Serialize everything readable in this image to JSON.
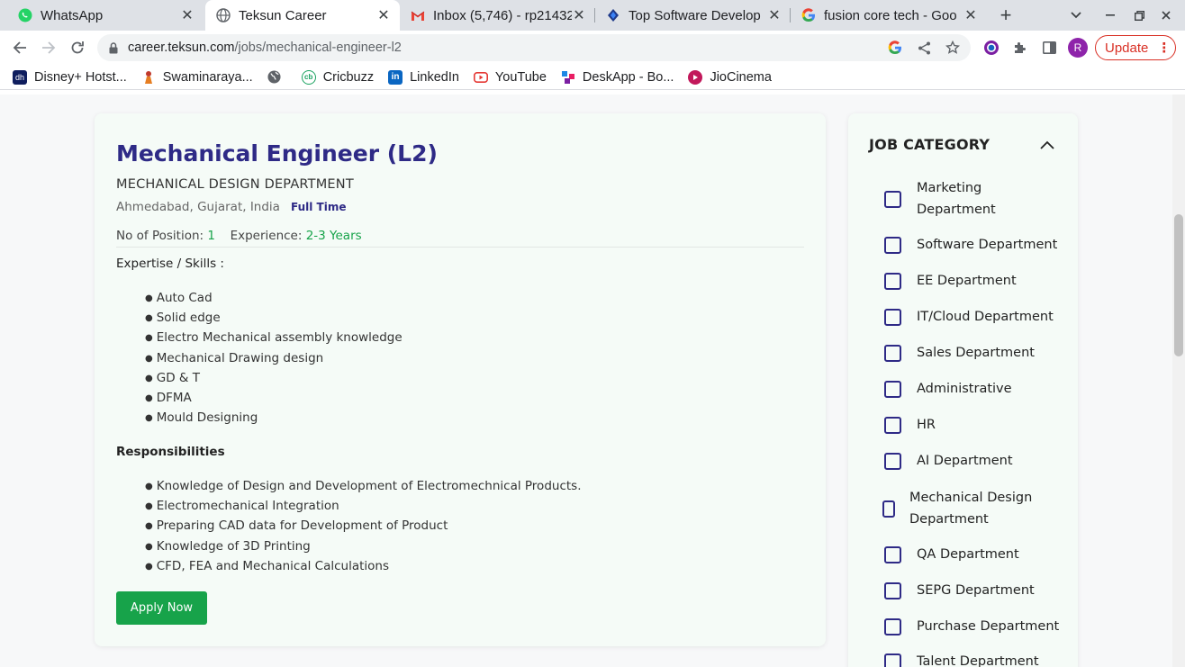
{
  "browser": {
    "tabs": [
      {
        "title": "WhatsApp",
        "icon": "whatsapp-icon"
      },
      {
        "title": "Teksun Career",
        "icon": "globe-icon"
      },
      {
        "title": "Inbox (5,746) - rp21432",
        "icon": "gmail-icon"
      },
      {
        "title": "Top Software Develop",
        "icon": "teksun-icon"
      },
      {
        "title": "fusion core tech - Goo",
        "icon": "google-icon"
      }
    ],
    "url_host": "career.teksun.com",
    "url_path": "/jobs/mechanical-engineer-l2",
    "avatar_letter": "R",
    "update_label": "Update",
    "bookmarks": [
      {
        "label": "Disney+ Hotst...",
        "icon": "hotstar-icon",
        "color": "#0f1e5e"
      },
      {
        "label": "Swaminaraya...",
        "icon": "swaminarayan-icon",
        "color": "#c0392b"
      },
      {
        "label": "",
        "icon": "globe-icon",
        "color": "#5f6368"
      },
      {
        "label": "Cricbuzz",
        "icon": "cricbuzz-icon",
        "color": "#1aa260"
      },
      {
        "label": "LinkedIn",
        "icon": "linkedin-icon",
        "color": "#0a66c2"
      },
      {
        "label": "YouTube",
        "icon": "youtube-icon",
        "color": "#e53935"
      },
      {
        "label": "DeskApp - Bo...",
        "icon": "deskapp-icon",
        "color": "#6a1b9a"
      },
      {
        "label": "JioCinema",
        "icon": "jiocinema-icon",
        "color": "#c2185b"
      }
    ]
  },
  "job": {
    "title": "Mechanical Engineer (L2)",
    "department": "MECHANICAL DESIGN DEPARTMENT",
    "location": "Ahmedabad, Gujarat, India",
    "type": "Full Time",
    "positions_label": "No of Position:",
    "positions_value": "1",
    "experience_label": "Experience:",
    "experience_value": "2-3 Years",
    "skills_heading": "Expertise / Skills :",
    "skills": [
      "Auto Cad",
      "Solid edge",
      "Electro Mechanical assembly knowledge",
      "Mechanical Drawing design",
      "GD & T",
      "DFMA",
      "Mould Designing"
    ],
    "responsibilities_heading": "Responsibilities",
    "responsibilities": [
      "Knowledge of Design and Development of Electromechnical Products.",
      "Electromechanical Integration",
      "Preparing CAD data for Development of Product",
      "Knowledge of 3D Printing",
      "CFD, FEA and Mechanical Calculations"
    ],
    "apply_label": "Apply Now"
  },
  "category": {
    "title": "JOB CATEGORY",
    "items": [
      "Marketing Department",
      "Software Department",
      "EE Department",
      "IT/Cloud Department",
      "Sales Department",
      "Administrative",
      "HR",
      "AI Department",
      "Mechanical Design Department",
      "QA Department",
      "SEPG Department",
      "Purchase Department",
      "Talent Department"
    ]
  },
  "colors": {
    "accent": "#2e2a86",
    "green": "#17a34a",
    "update": "#d93025"
  }
}
